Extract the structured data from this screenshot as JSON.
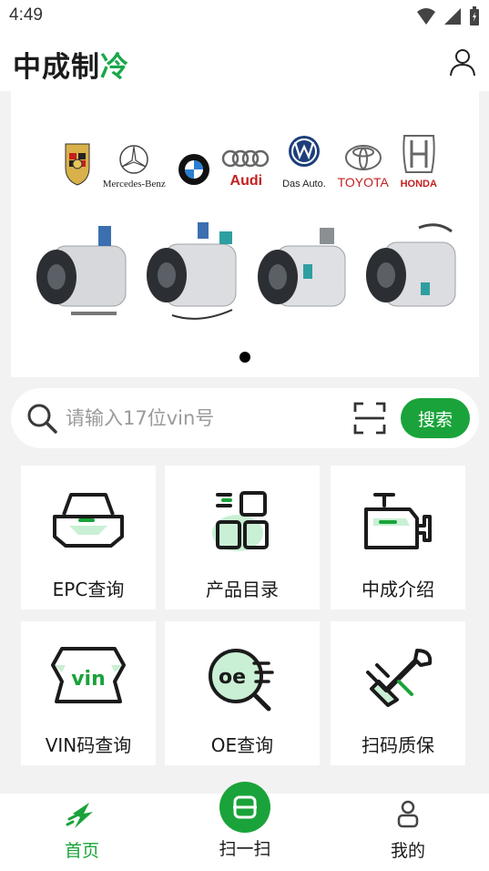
{
  "status_bar": {
    "time": "4:49"
  },
  "header": {
    "logo_dark": "中成制",
    "logo_green": "冷"
  },
  "banner": {
    "brands": [
      {
        "name": "",
        "icon": "porsche-logo"
      },
      {
        "name": "Mercedes-Benz",
        "icon": "mercedes-logo"
      },
      {
        "name": "",
        "icon": "bmw-logo"
      },
      {
        "name": "Audi",
        "icon": "audi-logo"
      },
      {
        "name": "Das Auto.",
        "icon": "vw-logo"
      },
      {
        "name": "TOYOTA",
        "icon": "toyota-logo"
      },
      {
        "name": "HONDA",
        "icon": "honda-logo"
      }
    ],
    "slide_count": 1,
    "active_slide": 0
  },
  "search": {
    "placeholder": "请输入17位vin号",
    "value": "",
    "button_label": "搜索"
  },
  "tiles": [
    {
      "label": "EPC查询",
      "icon": "car-front-icon"
    },
    {
      "label": "产品目录",
      "icon": "catalog-grid-icon"
    },
    {
      "label": "中成介绍",
      "icon": "engine-icon"
    },
    {
      "label": "VIN码查询",
      "icon": "vin-car-icon"
    },
    {
      "label": "OE查询",
      "icon": "oe-search-icon"
    },
    {
      "label": "扫码质保",
      "icon": "tools-icon"
    }
  ],
  "bottom_nav": {
    "home": "首页",
    "scan": "扫一扫",
    "mine": "我的"
  },
  "colors": {
    "accent": "#1aa33a",
    "accent_light": "#c9f0d4",
    "icon_dark": "#1b1b1b"
  }
}
